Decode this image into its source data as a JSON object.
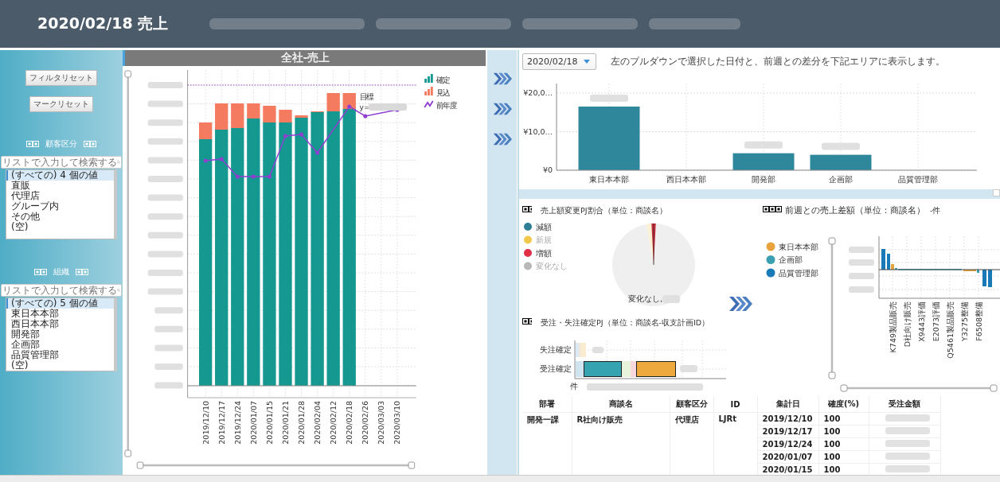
{
  "header": {
    "title": "2020/02/18 売上"
  },
  "sidebar": {
    "buttons": [
      "フィルタリセット",
      "マークリセット"
    ],
    "filters": [
      {
        "title": "顧客区分",
        "placeholder": "リストで入力して検索する",
        "items": [
          {
            "label": "(すべての) 4 個の値",
            "selected": true
          },
          {
            "label": "直販",
            "selected": false
          },
          {
            "label": "代理店",
            "selected": false
          },
          {
            "label": "グループ内",
            "selected": false
          },
          {
            "label": "その他",
            "selected": false
          },
          {
            "label": "(空)",
            "selected": false
          }
        ]
      },
      {
        "title": "組織",
        "placeholder": "リストで入力して検索する",
        "items": [
          {
            "label": "(すべての) 5 個の値",
            "selected": true
          },
          {
            "label": "東日本本部",
            "selected": false
          },
          {
            "label": "西日本本部",
            "selected": false
          },
          {
            "label": "開発部",
            "selected": false
          },
          {
            "label": "企画部",
            "selected": false
          },
          {
            "label": "品質管理部",
            "selected": false
          },
          {
            "label": "(空)",
            "selected": false
          }
        ]
      }
    ]
  },
  "main_chart": {
    "title": "全社-売上",
    "x_labels": [
      "2019/12/10",
      "2019/12/17",
      "2019/12/24",
      "2020/01/07",
      "2020/01/15",
      "2020/01/21",
      "2020/01/28",
      "2020/02/04",
      "2020/02/12",
      "2020/02/18",
      "2020/02/26",
      "2020/03/03",
      "2020/03/10"
    ],
    "legend": [
      {
        "label": "確定",
        "kind": "bar",
        "color": "#149890"
      },
      {
        "label": "見込",
        "kind": "bar",
        "color": "#f47a60"
      },
      {
        "label": "前年度",
        "kind": "line",
        "color": "#8f3fd0"
      }
    ],
    "target_label": "目標",
    "target_prefix": "y="
  },
  "right_panel": {
    "date_select": {
      "value": "2020/02/18"
    },
    "hint": "左のプルダウンで選択した日付と、前週との差分を下記エリアに表示します。",
    "dept_chart": {
      "y_labels": [
        "¥20,0…",
        "¥10,0…",
        "¥0"
      ],
      "categories": [
        "東日本本部",
        "西日本本部",
        "開発部",
        "企画部",
        "品質管理部"
      ]
    },
    "change_share": {
      "title": "売上額変更PJ割合（単位：商談名）",
      "legend": [
        {
          "label": "減額",
          "color": "#2e7f95",
          "dimmed": false
        },
        {
          "label": "新規",
          "color": "#f0c94a",
          "dimmed": true
        },
        {
          "label": "増額",
          "color": "#e03048",
          "dimmed": false
        },
        {
          "label": "変化なし",
          "color": "#b8b8b8",
          "dimmed": true
        }
      ],
      "pie_label": "変化なし,"
    },
    "order_status": {
      "title": "受注・失注確定PJ（単位：商談名-収支計画ID）",
      "categories": [
        "失注確定",
        "受注確定"
      ],
      "unit": "件"
    },
    "weekly_diff": {
      "title": "前週との売上差額（単位：商談名）",
      "count": "-件",
      "legend": [
        {
          "label": "東日本本部",
          "color": "#e8a33c"
        },
        {
          "label": "企画部",
          "color": "#3a9fb0"
        },
        {
          "label": "品質管理部",
          "color": "#1a7ab8"
        }
      ],
      "categories": [
        "K749製品販売",
        "D社向け販売",
        "X9443評価",
        "E2073評価",
        "Q5461製品販売",
        "Y3275整備",
        "F6508整備"
      ]
    },
    "table": {
      "columns": [
        "部署",
        "商談名",
        "顧客区分",
        "ID",
        "集計日",
        "確度(%)",
        "受注金額"
      ],
      "group": {
        "department": "開発一課",
        "deal": "R社向け販売",
        "customer_type": "代理店",
        "id": "LJRt",
        "entries": [
          {
            "date": "2019/12/10",
            "certainty": "100"
          },
          {
            "date": "2019/12/17",
            "certainty": "100"
          },
          {
            "date": "2019/12/24",
            "certainty": "100"
          },
          {
            "date": "2020/01/07",
            "certainty": "100"
          },
          {
            "date": "2020/01/15",
            "certainty": "100"
          }
        ]
      }
    }
  }
}
